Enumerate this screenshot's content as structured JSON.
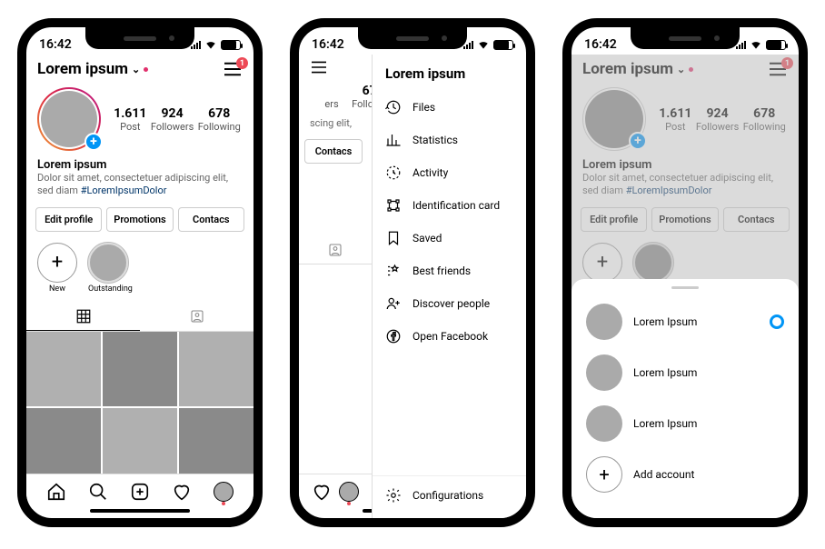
{
  "status": {
    "time": "16:42"
  },
  "colors": {
    "accent": "#0095f6",
    "badge": "#ed4956",
    "link": "#003569"
  },
  "profile": {
    "username": "Lorem ipsum",
    "posts_count": "1.611",
    "posts_label": "Post",
    "followers_count": "924",
    "followers_label": "Followers",
    "following_count": "678",
    "following_label": "Following",
    "display_name": "Lorem ipsum",
    "bio_text": "Dolor sit amet, consectetuer adipiscing elit, sed diam ",
    "bio_hashtag": "#LoremIpsumDolor"
  },
  "buttons": {
    "edit": "Edit profile",
    "promotions": "Promotions",
    "contacts": "Contacs"
  },
  "highlights": {
    "new": "New",
    "outstanding": "Outstanding"
  },
  "menu_badge": "1",
  "drawer": {
    "title": "Lorem ipsum",
    "items": [
      {
        "icon": "history",
        "label": "Files"
      },
      {
        "icon": "stats",
        "label": "Statistics"
      },
      {
        "icon": "activity",
        "label": "Activity"
      },
      {
        "icon": "idcard",
        "label": "Identification card"
      },
      {
        "icon": "bookmark",
        "label": "Saved"
      },
      {
        "icon": "bestfriends",
        "label": "Best friends"
      },
      {
        "icon": "discover",
        "label": "Discover people"
      },
      {
        "icon": "facebook",
        "label": "Open Facebook"
      }
    ],
    "config": "Configurations"
  },
  "sheet": {
    "accounts": [
      {
        "label": "Lorem Ipsum",
        "selected": true
      },
      {
        "label": "Lorem Ipsum",
        "selected": false
      },
      {
        "label": "Lorem Ipsum",
        "selected": false
      }
    ],
    "add": "Add account"
  }
}
